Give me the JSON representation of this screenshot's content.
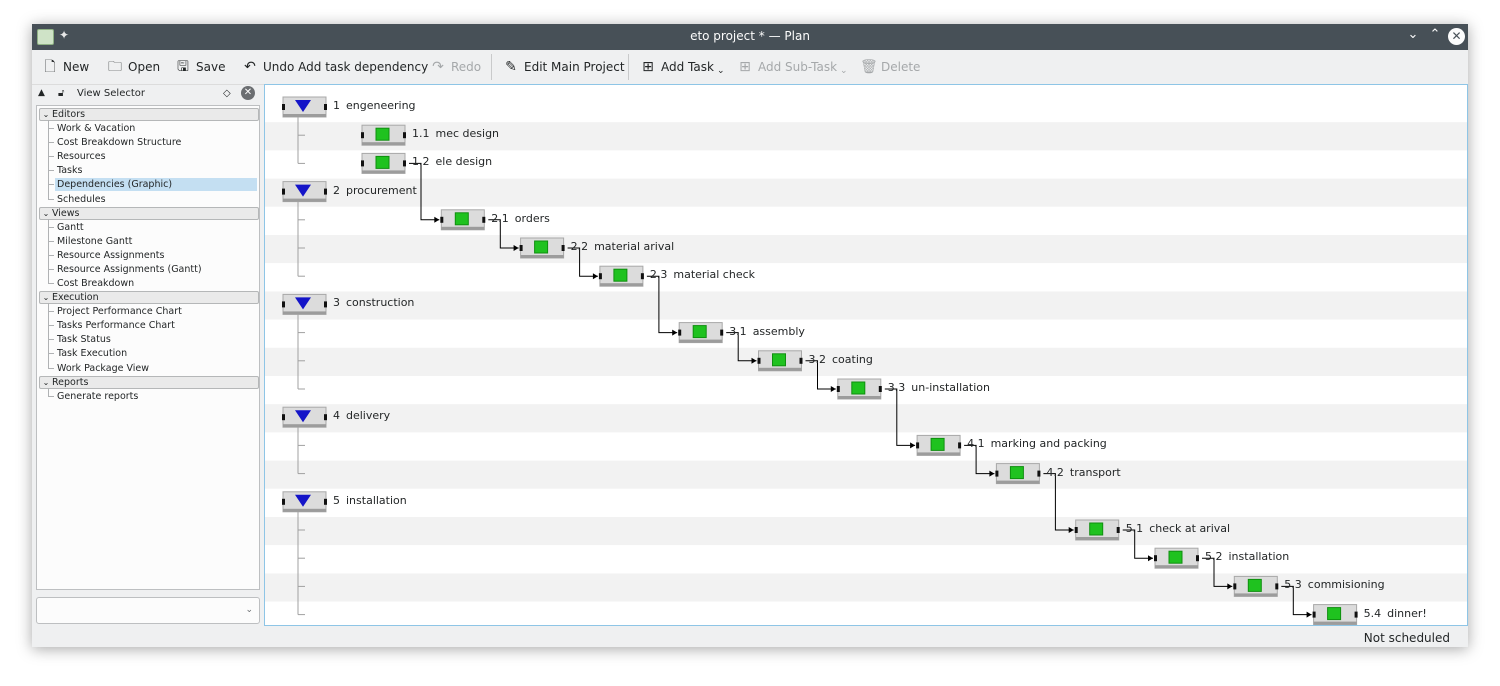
{
  "window": {
    "title": "eto project * — Plan",
    "minimize_glyph": "⌄",
    "maximize_glyph": "⌃",
    "close_glyph": "✕"
  },
  "toolbar": {
    "new": "New",
    "open": "Open",
    "save": "Save",
    "undo": "Undo Add task dependency",
    "redo": "Redo",
    "edit_main": "Edit Main Project",
    "add_task": "Add Task",
    "add_subtask": "Add Sub-Task",
    "delete": "Delete"
  },
  "view_selector": {
    "title": "View Selector",
    "sections": [
      {
        "label": "Editors",
        "items": [
          "Work & Vacation",
          "Cost Breakdown Structure",
          "Resources",
          "Tasks",
          "Dependencies (Graphic)",
          "Schedules"
        ]
      },
      {
        "label": "Views",
        "items": [
          "Gantt",
          "Milestone Gantt",
          "Resource Assignments",
          "Resource Assignments (Gantt)",
          "Cost Breakdown"
        ]
      },
      {
        "label": "Execution",
        "items": [
          "Project Performance Chart",
          "Tasks Performance Chart",
          "Task Status",
          "Task Execution",
          "Work Package View"
        ]
      },
      {
        "label": "Reports",
        "items": [
          "Generate reports"
        ]
      }
    ],
    "selected": "Dependencies (Graphic)"
  },
  "tasks": [
    {
      "wbs": "1",
      "name": "engeneering",
      "summary": true
    },
    {
      "wbs": "1.1",
      "name": "mec design"
    },
    {
      "wbs": "1.2",
      "name": "ele design"
    },
    {
      "wbs": "2",
      "name": "procurement",
      "summary": true
    },
    {
      "wbs": "2.1",
      "name": "orders"
    },
    {
      "wbs": "2.2",
      "name": "material arival"
    },
    {
      "wbs": "2.3",
      "name": "material check"
    },
    {
      "wbs": "3",
      "name": "construction",
      "summary": true
    },
    {
      "wbs": "3.1",
      "name": "assembly"
    },
    {
      "wbs": "3.2",
      "name": "coating"
    },
    {
      "wbs": "3.3",
      "name": "un-installation"
    },
    {
      "wbs": "4",
      "name": "delivery",
      "summary": true
    },
    {
      "wbs": "4.1",
      "name": "marking and packing"
    },
    {
      "wbs": "4.2",
      "name": "transport"
    },
    {
      "wbs": "5",
      "name": "installation",
      "summary": true
    },
    {
      "wbs": "5.1",
      "name": "check at arival"
    },
    {
      "wbs": "5.2",
      "name": "installation"
    },
    {
      "wbs": "5.3",
      "name": "commisioning"
    },
    {
      "wbs": "5.4",
      "name": "dinner!"
    }
  ],
  "dependencies": [
    [
      "1.2",
      "2.1"
    ],
    [
      "2.1",
      "2.2"
    ],
    [
      "2.2",
      "2.3"
    ],
    [
      "2.3",
      "3.1"
    ],
    [
      "3.1",
      "3.2"
    ],
    [
      "3.2",
      "3.3"
    ],
    [
      "3.3",
      "4.1"
    ],
    [
      "4.1",
      "4.2"
    ],
    [
      "4.2",
      "5.1"
    ],
    [
      "5.1",
      "5.2"
    ],
    [
      "5.2",
      "5.3"
    ],
    [
      "5.3",
      "5.4"
    ]
  ],
  "status": {
    "text": "Not scheduled"
  },
  "colors": {
    "task_green": "#1fc21f",
    "summary_blue": "#1414c8",
    "selection": "#c4dff2",
    "titlebar": "#475057"
  }
}
